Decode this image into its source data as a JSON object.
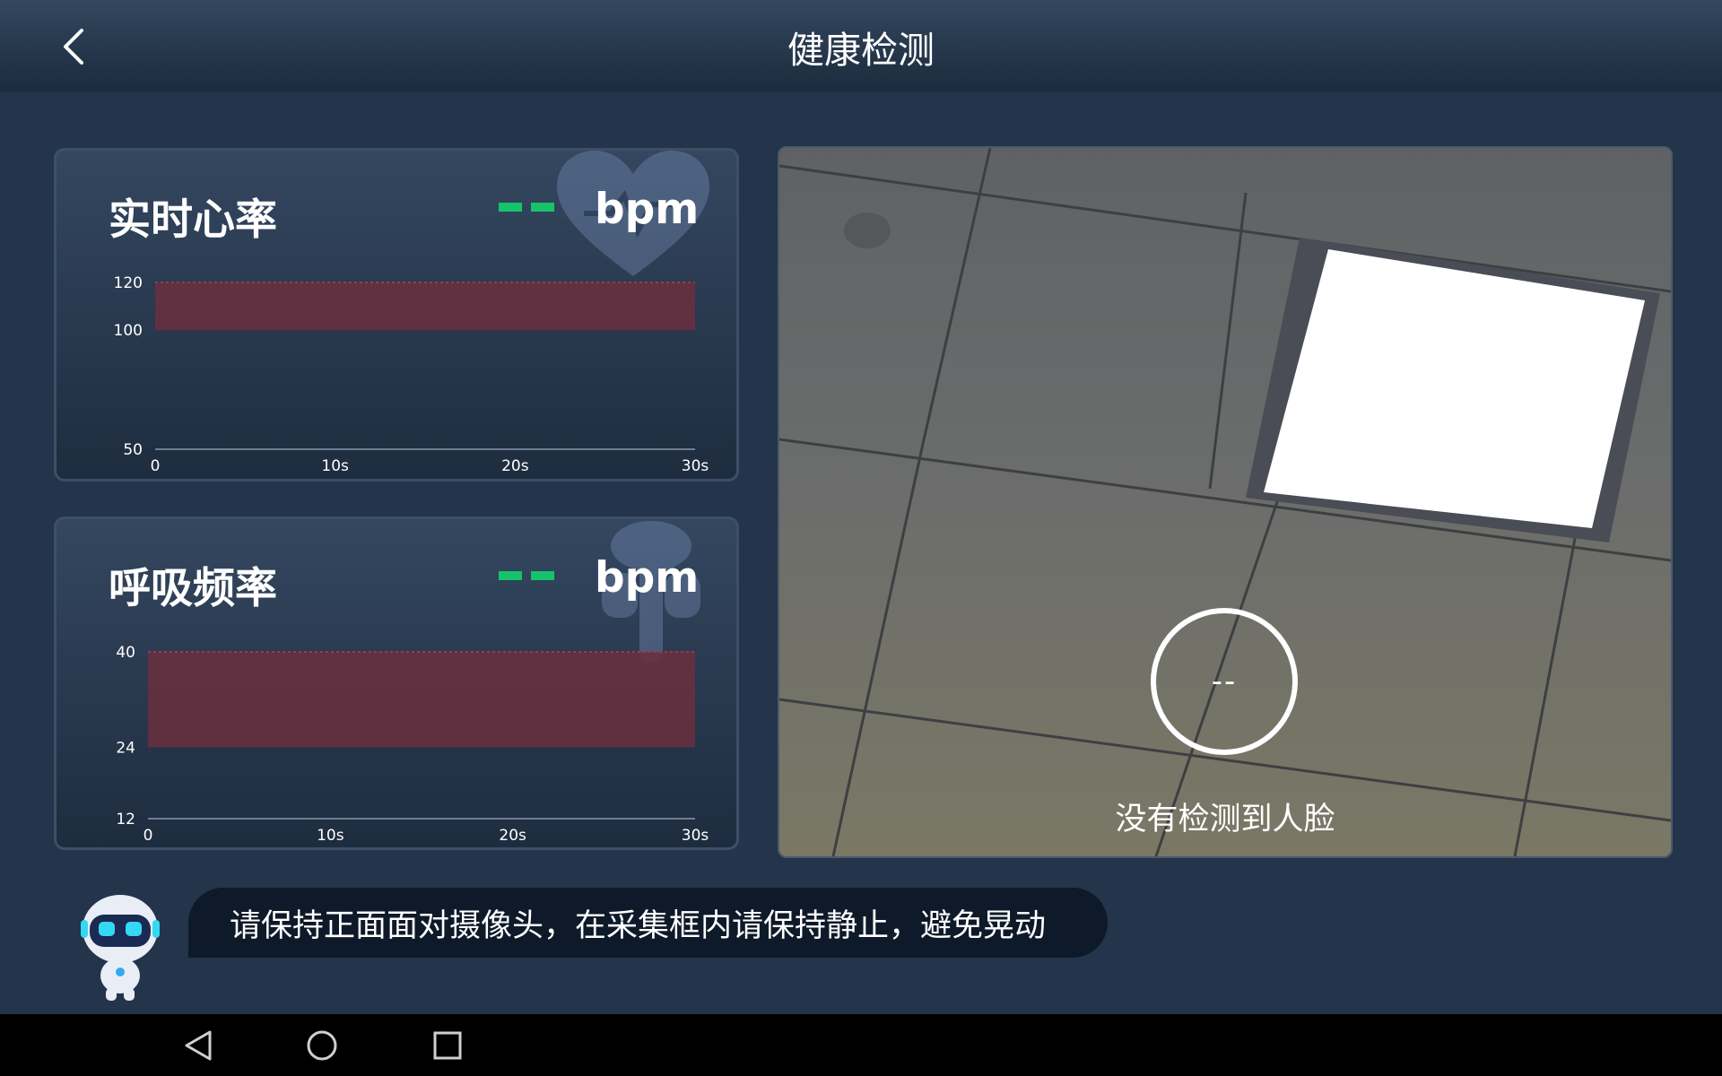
{
  "header": {
    "title": "健康检测",
    "back_icon": "chevron-left-icon"
  },
  "heart_rate": {
    "title": "实时心率",
    "value": "--",
    "unit": "bpm",
    "icon": "heart-icon",
    "chart_data": {
      "type": "line",
      "title": "",
      "x_ticks": [
        "0",
        "10s",
        "20s",
        "30s"
      ],
      "y_ticks": [
        {
          "label": "120",
          "value": 120
        },
        {
          "label": "100",
          "value": 100
        },
        {
          "label": "50",
          "value": 50
        }
      ],
      "ylim": [
        50,
        120
      ],
      "xlim": [
        0,
        30
      ],
      "alert_band": [
        100,
        120
      ],
      "series": [],
      "colors": {
        "band": "#6b2f3e",
        "value": "#16c36b"
      }
    }
  },
  "respiration": {
    "title": "呼吸频率",
    "value": "--",
    "unit": "bpm",
    "icon": "lungs-icon",
    "chart_data": {
      "type": "line",
      "title": "",
      "x_ticks": [
        "0",
        "10s",
        "20s",
        "30s"
      ],
      "y_ticks": [
        {
          "label": "40",
          "value": 40
        },
        {
          "label": "24",
          "value": 24
        },
        {
          "label": "12",
          "value": 12
        }
      ],
      "ylim": [
        12,
        40
      ],
      "xlim": [
        0,
        30
      ],
      "alert_band": [
        24,
        40
      ],
      "series": [],
      "colors": {
        "band": "#6b2f3e",
        "value": "#16c36b"
      }
    }
  },
  "camera": {
    "ring_value": "--",
    "status": "没有检测到人脸"
  },
  "hint": {
    "text": "请保持正面面对摄像头，在采集框内请保持静止，避免晃动",
    "mascot_icon": "robot-mascot-icon"
  },
  "nav": {
    "back_icon": "triangle-back-icon",
    "home_icon": "circle-home-icon",
    "recents_icon": "square-recents-icon"
  }
}
